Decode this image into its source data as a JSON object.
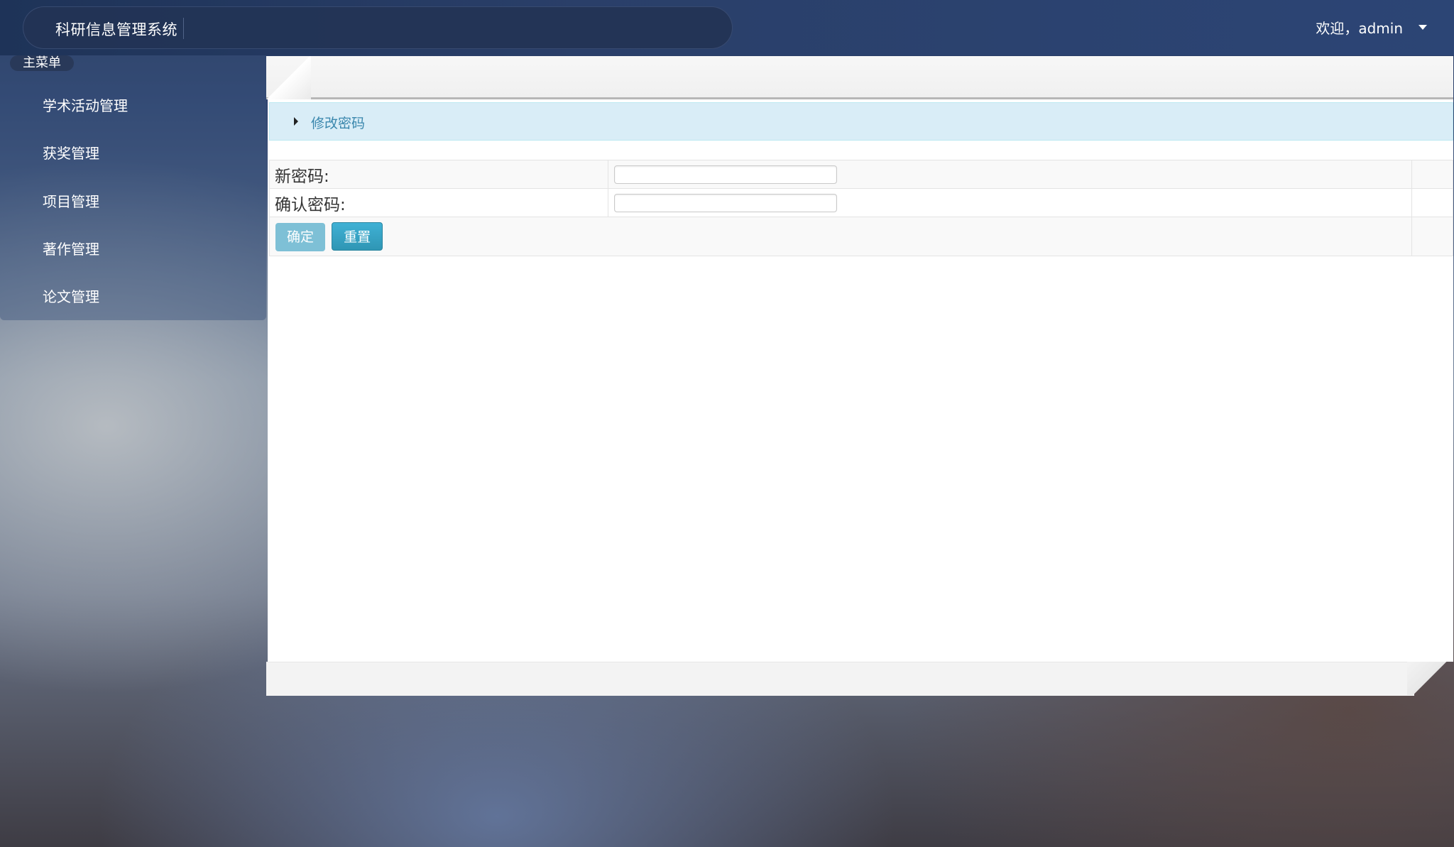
{
  "header": {
    "app_title": "科研信息管理系统",
    "welcome_text": "欢迎，admin"
  },
  "sidebar": {
    "menu_header": "主菜单",
    "items": [
      {
        "label": "学术活动管理"
      },
      {
        "label": "获奖管理"
      },
      {
        "label": "项目管理"
      },
      {
        "label": "著作管理"
      },
      {
        "label": "论文管理"
      }
    ]
  },
  "main": {
    "section_title": "修改密码",
    "form": {
      "new_password_label": "新密码:",
      "new_password_value": "",
      "confirm_password_label": "确认密码:",
      "confirm_password_value": "",
      "confirm_button": "确定",
      "reset_button": "重置"
    }
  },
  "colors": {
    "section_bar_bg": "#d9edf7",
    "section_title": "#3a87ad",
    "confirm_button_bg": "#7ec0d6",
    "reset_button_bg": "#2f96b4"
  }
}
